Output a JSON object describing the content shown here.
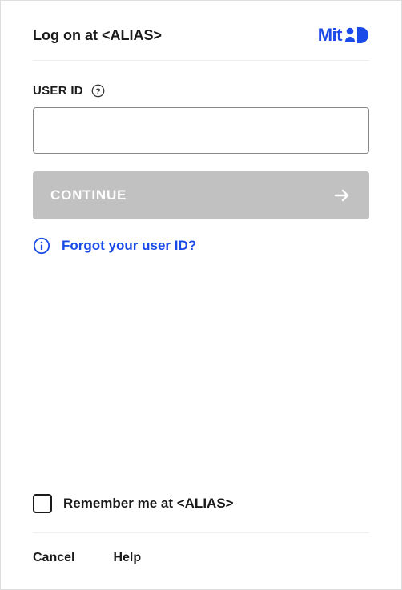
{
  "header": {
    "title": "Log on at <ALIAS>",
    "logo_text": "Mit"
  },
  "field": {
    "label": "USER ID",
    "value": ""
  },
  "continue": {
    "label": "CONTINUE"
  },
  "forgot": {
    "label": "Forgot your user ID?"
  },
  "remember": {
    "label": "Remember me at <ALIAS>",
    "checked": false
  },
  "footer": {
    "cancel": "Cancel",
    "help": "Help"
  },
  "colors": {
    "brand": "#1a4ae8",
    "disabled": "#c1c1c1"
  }
}
